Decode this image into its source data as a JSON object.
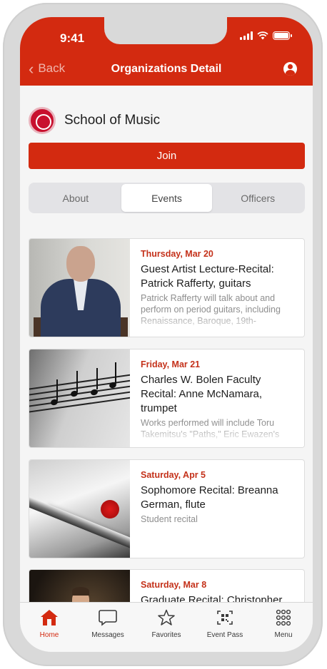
{
  "status_bar": {
    "time": "9:41"
  },
  "nav": {
    "back_label": "Back",
    "title": "Organizations Detail",
    "profile_icon": "account-circle-icon"
  },
  "organization": {
    "name": "School of Music",
    "join_label": "Join"
  },
  "tabs": [
    {
      "label": "About",
      "active": false
    },
    {
      "label": "Events",
      "active": true
    },
    {
      "label": "Officers",
      "active": false
    }
  ],
  "events": [
    {
      "date": "Thursday, Mar 20",
      "title": "Guest Artist Lecture-Recital: Patrick Rafferty, guitars",
      "description": "Patrick Rafferty will talk about and perform on period guitars, including Renaissance, Baroque, 19th-"
    },
    {
      "date": "Friday, Mar 21",
      "title": "Charles W. Bolen Faculty Recital: Anne McNamara, trumpet",
      "description": "Works performed will include Toru Takemitsu's \"Paths,\" Eric Ewazen's"
    },
    {
      "date": "Saturday, Apr 5",
      "title": "Sophomore Recital: Breanna German, flute",
      "description": "Student recital"
    },
    {
      "date": "Saturday, Mar 8",
      "title": "Graduate Recital: Christopher Bulding, conducting",
      "description": ""
    }
  ],
  "tabbar": [
    {
      "label": "Home",
      "icon": "home-icon",
      "active": true
    },
    {
      "label": "Messages",
      "icon": "message-icon",
      "active": false
    },
    {
      "label": "Favorites",
      "icon": "star-icon",
      "active": false
    },
    {
      "label": "Event Pass",
      "icon": "qr-code-icon",
      "active": false
    },
    {
      "label": "Menu",
      "icon": "grid-menu-icon",
      "active": false
    }
  ],
  "colors": {
    "accent": "#d32a10",
    "date_text": "#c4311a"
  }
}
